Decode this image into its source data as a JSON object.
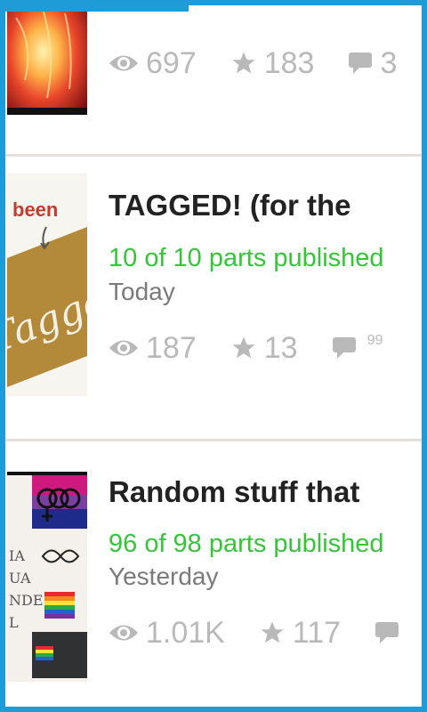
{
  "progress": 0.44,
  "stories": [
    {
      "views": "697",
      "votes": "183",
      "comments": "3"
    },
    {
      "title": "TAGGED! (for the",
      "parts": "10 of 10 parts published",
      "date": "Today",
      "views": "187",
      "votes": "13",
      "comments": "99",
      "cover_text": "been",
      "cover_word": "Tagged"
    },
    {
      "title": "Random stuff that",
      "parts": "96 of 98 parts published",
      "date": "Yesterday",
      "views": "1.01K",
      "votes": "117",
      "comments": ""
    }
  ],
  "colors": {
    "accent": "#1f9bd8",
    "published": "#36c43b",
    "stat": "#b9b9b9",
    "title": "#222222"
  },
  "icons": {
    "views": "eye-icon",
    "votes": "star-icon",
    "comments": "comment-bubble-icon"
  }
}
